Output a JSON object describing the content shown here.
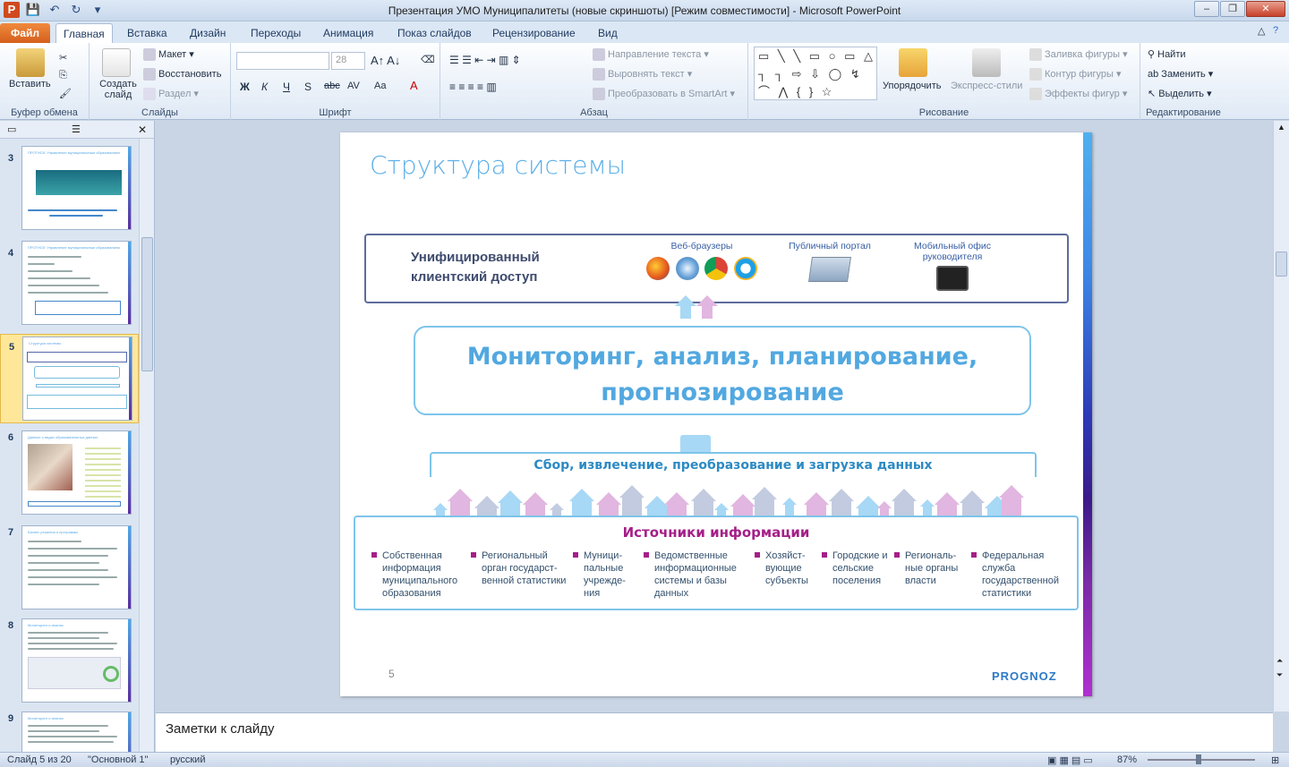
{
  "window": {
    "title": "Презентация  УМО Муниципалитеты (новые скриншоты) [Режим совместимости]  -  Microsoft PowerPoint",
    "buttons": [
      "–",
      "❐",
      "✕"
    ]
  },
  "tabs": [
    {
      "label": "Файл"
    },
    {
      "label": "Главная"
    },
    {
      "label": "Вставка"
    },
    {
      "label": "Дизайн"
    },
    {
      "label": "Переходы"
    },
    {
      "label": "Анимация"
    },
    {
      "label": "Показ слайдов"
    },
    {
      "label": "Рецензирование"
    },
    {
      "label": "Вид"
    }
  ],
  "ribbon": {
    "clipboard": {
      "paste": "Вставить",
      "label": "Буфер обмена"
    },
    "slides": {
      "create": "Создать слайд",
      "layout": "Макет",
      "reset": "Восстановить",
      "section": "Раздел",
      "label": "Слайды"
    },
    "font": {
      "size": "28",
      "label": "Шрифт",
      "bold": "Ж",
      "italic": "К",
      "underline": "Ч",
      "shadow": "S",
      "strike": "abc",
      "spacing": "AV",
      "case": "Aa",
      "color": "A"
    },
    "paragraph": {
      "direction": "Направление текста",
      "align": "Выровнять текст",
      "smartart": "Преобразовать в SmartArt",
      "label": "Абзац"
    },
    "drawing": {
      "arrange": "Упорядочить",
      "styles": "Экспресс-стили",
      "fill": "Заливка фигуры",
      "outline": "Контур фигуры",
      "effects": "Эффекты фигур",
      "label": "Рисование",
      "shapes": "▭ ╲ ╲ ▭ ○ ▭ △ ┐ ┐ ⇨ ⇩ ◯ ↯ ⌒ ⋀ { } ☆"
    },
    "editing": {
      "find": "Найти",
      "replace": "Заменить",
      "select": "Выделить",
      "label": "Редактирование"
    }
  },
  "thumbnails": [
    {
      "num": "3",
      "title": "ПРОГНОЗ: Управление муниципальным образованием"
    },
    {
      "num": "4",
      "title": "ПРОГНОЗ: Управление муниципальным образованием"
    },
    {
      "num": "5",
      "title": "Структура системы"
    },
    {
      "num": "6",
      "title": "Данные о видах образовательных данных"
    },
    {
      "num": "7",
      "title": "Бизнес решения и программы"
    },
    {
      "num": "8",
      "title": "Мониторинг и анализ"
    },
    {
      "num": "9",
      "title": "Мониторинг и анализ"
    }
  ],
  "slide": {
    "title": "Структура системы",
    "client_access": "Унифицированный клиентский доступ",
    "client_groups": [
      "Веб-браузеры",
      "Публичный портал",
      "Мобильный офис руководителя"
    ],
    "monitoring": "Мониторинг, анализ, планирование, прогнозирование",
    "collect": "Сбор, извлечение, преобразование и загрузка данных",
    "sources_title": "Источники информации",
    "sources": [
      "Собственная информация муниципального образования",
      "Региональный орган государст-венной статистики",
      "Муници-пальные учрежде-ния",
      "Ведомственные информационные системы и базы данных",
      "Хозяйст-вующие субъекты",
      "Городские и сельские поселения",
      "Региональ-ные органы власти",
      "Федеральная служба государственной статистики"
    ],
    "number": "5",
    "logo": "PROGNOZ"
  },
  "notes": {
    "placeholder": "Заметки к слайду"
  },
  "status": {
    "slide": "Слайд 5 из 20",
    "theme": "\"Основной 1\"",
    "lang": "русский",
    "zoom": "87%"
  }
}
